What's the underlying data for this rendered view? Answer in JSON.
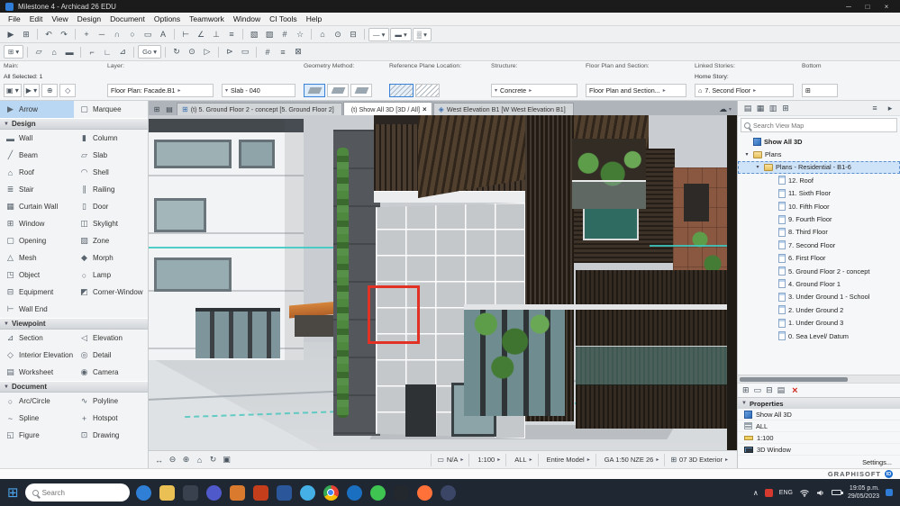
{
  "titlebar": {
    "title": "Milestone 4 - Archicad 26 EDU",
    "minimize": "─",
    "maximize": "□",
    "close": "×"
  },
  "menubar": {
    "items": [
      "File",
      "Edit",
      "View",
      "Design",
      "Document",
      "Options",
      "Teamwork",
      "Window",
      "CI Tools",
      "Help"
    ]
  },
  "toolbar_row1": {
    "icons": [
      {
        "n": "select-arrow-icon",
        "g": "▶"
      },
      {
        "n": "marquee-icon",
        "g": "⊞"
      },
      {
        "n": "sep",
        "g": "",
        "c": "sep"
      },
      {
        "n": "undo-icon",
        "g": "↶"
      },
      {
        "n": "redo-icon",
        "g": "↷"
      },
      {
        "n": "sep",
        "g": "",
        "c": "sep"
      },
      {
        "n": "pan-icon",
        "g": "+"
      },
      {
        "n": "line-icon",
        "g": "─"
      },
      {
        "n": "arc-icon",
        "g": "∩"
      },
      {
        "n": "circle-icon",
        "g": "○"
      },
      {
        "n": "rect-icon",
        "g": "▭"
      },
      {
        "n": "text-icon",
        "g": "A"
      },
      {
        "n": "sep",
        "g": "",
        "c": "sep"
      },
      {
        "n": "dimension-icon",
        "g": "⊢"
      },
      {
        "n": "angle-icon",
        "g": "∠"
      },
      {
        "n": "level-icon",
        "g": "⊥"
      },
      {
        "n": "label-icon",
        "g": "≡"
      },
      {
        "n": "sep",
        "g": "",
        "c": "sep"
      },
      {
        "n": "zone-fill-icon",
        "g": "▧"
      },
      {
        "n": "hatch-icon",
        "g": "▨"
      },
      {
        "n": "grid-snap-icon",
        "g": "#"
      },
      {
        "n": "favorites-icon",
        "g": "☆"
      },
      {
        "n": "sep",
        "g": "",
        "c": "sep"
      },
      {
        "n": "home-story-icon",
        "g": "⌂"
      },
      {
        "n": "camera-path-icon",
        "g": "⊙"
      },
      {
        "n": "layer-combine-icon",
        "g": "⊟"
      },
      {
        "n": "sep",
        "g": "",
        "c": "sep"
      },
      {
        "n": "linetype-dropdown",
        "g": "— ▾",
        "c": "chip"
      },
      {
        "n": "pen-dropdown",
        "g": "▬ ▾",
        "c": "chip"
      },
      {
        "n": "fill-dropdown",
        "g": "▒ ▾",
        "c": "chip"
      }
    ]
  },
  "toolbar_row2": {
    "icons": [
      {
        "n": "view-settings-dropdown",
        "g": "⊞ ▾",
        "c": "chip"
      },
      {
        "n": "sep",
        "g": "",
        "c": "sep"
      },
      {
        "n": "slab-edit-icon",
        "g": "▱"
      },
      {
        "n": "roof-edit-icon",
        "g": "⌂"
      },
      {
        "n": "wall-edit-icon",
        "g": "▬"
      },
      {
        "n": "sep",
        "g": "",
        "c": "sep"
      },
      {
        "n": "corner-icon",
        "g": "⌐"
      },
      {
        "n": "angle-icon",
        "g": "∟"
      },
      {
        "n": "triangle-icon",
        "g": "⊿"
      },
      {
        "n": "sep",
        "g": "",
        "c": "sep"
      },
      {
        "n": "go-dropdown",
        "g": "Go ▾",
        "c": "chip"
      },
      {
        "n": "sep",
        "g": "",
        "c": "sep"
      },
      {
        "n": "rotate-view-icon",
        "g": "↻"
      },
      {
        "n": "orbit-icon",
        "g": "⊙"
      },
      {
        "n": "walkthrough-icon",
        "g": "▷"
      },
      {
        "n": "sep",
        "g": "",
        "c": "sep"
      },
      {
        "n": "markup-flag-icon",
        "g": "⊳"
      },
      {
        "n": "note-icon",
        "g": "▭"
      },
      {
        "n": "sep",
        "g": "",
        "c": "sep"
      },
      {
        "n": "hash-icon",
        "g": "#"
      },
      {
        "n": "list-icon",
        "g": "≡"
      },
      {
        "n": "close-box-icon",
        "g": "⊠"
      }
    ]
  },
  "infobar": {
    "main_label": "Main:",
    "selected_text": "All Selected: 1",
    "main_icons": [
      {
        "n": "default-settings-icon",
        "g": "▣ ▾"
      },
      {
        "n": "arrow-mode-icon",
        "g": "▶ ▾"
      },
      {
        "n": "add-mode-icon",
        "g": "⊕"
      },
      {
        "n": "transform-icon",
        "g": "◇"
      }
    ],
    "layer_label": "Layer:",
    "layer_value": "Floor Plan: Facade.B1",
    "id_value": "Slab - 040",
    "geometry_label": "Geometry Method:",
    "refplane_label": "Reference Plane Location:",
    "structure_label": "Structure:",
    "structure_value": "Concrete",
    "fps_label": "Floor Plan and Section:",
    "fps_value": "Floor Plan and Section...",
    "linked_label": "Linked Stories:",
    "home_story_label": "Home Story:",
    "home_story_value": "7. Second Floor",
    "bottom_label": "Bottom"
  },
  "tabbar": {
    "left_icons": [
      {
        "n": "quick-options-icon",
        "g": "⊞"
      },
      {
        "n": "tab-overview-icon",
        "g": "▤"
      }
    ],
    "tabs": [
      {
        "label": "(t) 5. Ground Floor 2 - concept [5. Ground Floor 2]",
        "icon": "⊞",
        "close": "",
        "cls": ""
      },
      {
        "label": "(t) Show All 3D [3D / All]",
        "icon": "",
        "close": "×",
        "cls": "active"
      },
      {
        "label": "West Elevation B1 [W West Elevation B1]",
        "icon": "◈",
        "close": "",
        "cls": ""
      }
    ],
    "cloud_icon": "☁",
    "cloud_caret": "▾"
  },
  "toolbox": {
    "select_tools": [
      {
        "label": "Arrow",
        "icon": "▶",
        "cls": "sel"
      },
      {
        "label": "Marquee",
        "icon": "▢",
        "cls": ""
      }
    ],
    "design_header": "Design",
    "design_tools": [
      {
        "label": "Wall",
        "icon": "▬"
      },
      {
        "label": "Column",
        "icon": "▮"
      },
      {
        "label": "Beam",
        "icon": "╱"
      },
      {
        "label": "Slab",
        "icon": "▱"
      },
      {
        "label": "Roof",
        "icon": "⌂"
      },
      {
        "label": "Shell",
        "icon": "◠"
      },
      {
        "label": "Stair",
        "icon": "≣"
      },
      {
        "label": "Railing",
        "icon": "∥"
      },
      {
        "label": "Curtain Wall",
        "icon": "▦"
      },
      {
        "label": "Door",
        "icon": "▯"
      },
      {
        "label": "Window",
        "icon": "⊞"
      },
      {
        "label": "Skylight",
        "icon": "◫"
      },
      {
        "label": "Opening",
        "icon": "▢"
      },
      {
        "label": "Zone",
        "icon": "▨"
      },
      {
        "label": "Mesh",
        "icon": "△"
      },
      {
        "label": "Morph",
        "icon": "◆"
      },
      {
        "label": "Object",
        "icon": "◳"
      },
      {
        "label": "Lamp",
        "icon": "○"
      },
      {
        "label": "Equipment",
        "icon": "⊟"
      },
      {
        "label": "Corner-Window",
        "icon": "◩"
      },
      {
        "label": "Wall End",
        "icon": "⊢"
      }
    ],
    "viewpoint_header": "Viewpoint",
    "viewpoint_tools": [
      {
        "label": "Section",
        "icon": "⊿"
      },
      {
        "label": "Elevation",
        "icon": "◁"
      },
      {
        "label": "Interior Elevation",
        "icon": "◇"
      },
      {
        "label": "Detail",
        "icon": "◎"
      },
      {
        "label": "Worksheet",
        "icon": "▤"
      },
      {
        "label": "Camera",
        "icon": "◉"
      }
    ],
    "document_header": "Document",
    "document_tools": [
      {
        "label": "Arc/Circle",
        "icon": "○"
      },
      {
        "label": "Polyline",
        "icon": "∿"
      },
      {
        "label": "Spline",
        "icon": "~"
      },
      {
        "label": "Hotspot",
        "icon": "+"
      },
      {
        "label": "Figure",
        "icon": "◱"
      },
      {
        "label": "Drawing",
        "icon": "⊡"
      }
    ]
  },
  "navigator": {
    "header_icons": [
      {
        "n": "project-chooser-icon",
        "g": "▤"
      },
      {
        "n": "view-map-icon",
        "g": "▦"
      },
      {
        "n": "layout-book-icon",
        "g": "▥"
      },
      {
        "n": "publisher-icon",
        "g": "⊞"
      }
    ],
    "menu_icon": "≡",
    "expand_icon": "▸",
    "search_placeholder": "Search View Map",
    "tree": [
      {
        "label": "Show All 3D",
        "icon": "i-cube",
        "arrow": "",
        "cls": "lvl0 bold"
      },
      {
        "label": "Plans",
        "icon": "i-folder",
        "arrow": "▾",
        "cls": "lvl0"
      },
      {
        "label": "Plans - Residential - B1-6",
        "icon": "i-folder",
        "arrow": "▾",
        "cls": "lvl1 selected"
      },
      {
        "label": "12. Roof",
        "icon": "i-plan",
        "arrow": "",
        "cls": "lvl2"
      },
      {
        "label": "11. Sixth Floor",
        "icon": "i-plan",
        "arrow": "",
        "cls": "lvl2"
      },
      {
        "label": "10. Fifth Floor",
        "icon": "i-plan",
        "arrow": "",
        "cls": "lvl2"
      },
      {
        "label": "9. Fourth Floor",
        "icon": "i-plan",
        "arrow": "",
        "cls": "lvl2"
      },
      {
        "label": "8. Third Floor",
        "icon": "i-plan",
        "arrow": "",
        "cls": "lvl2"
      },
      {
        "label": "7. Second Floor",
        "icon": "i-plan",
        "arrow": "",
        "cls": "lvl2"
      },
      {
        "label": "6. First Floor",
        "icon": "i-plan",
        "arrow": "",
        "cls": "lvl2"
      },
      {
        "label": "5. Ground Floor 2 - concept",
        "icon": "i-plan",
        "arrow": "",
        "cls": "lvl2"
      },
      {
        "label": "4. Ground Floor 1",
        "icon": "i-plan",
        "arrow": "",
        "cls": "lvl2"
      },
      {
        "label": "3. Under Ground 1 - School",
        "icon": "i-plan",
        "arrow": "",
        "cls": "lvl2"
      },
      {
        "label": "2. Under Ground 2",
        "icon": "i-plan",
        "arrow": "",
        "cls": "lvl2"
      },
      {
        "label": "1. Under Ground 3",
        "icon": "i-plan",
        "arrow": "",
        "cls": "lvl2"
      },
      {
        "label": "0. Sea Level/ Datum",
        "icon": "i-plan",
        "arrow": "",
        "cls": "lvl2"
      }
    ],
    "tool_icons": [
      {
        "n": "new-viewpoint-icon",
        "g": "⊞"
      },
      {
        "n": "edit-view-icon",
        "g": "▭"
      },
      {
        "n": "clone-folder-icon",
        "g": "⊟"
      },
      {
        "n": "save-view-icon",
        "g": "▤"
      }
    ],
    "delete_icon": "×"
  },
  "properties": {
    "header": "Properties",
    "rows": [
      {
        "label": "Show All 3D",
        "icon": "i-cube"
      },
      {
        "label": "ALL",
        "icon": "i-layers"
      },
      {
        "label": "1:100",
        "icon": "i-scale"
      },
      {
        "label": "3D Window",
        "icon": "i-monitor"
      }
    ],
    "settings_label": "Settings..."
  },
  "statusbar": {
    "icons": [
      {
        "n": "pan-icon",
        "g": "↔"
      },
      {
        "n": "zoom-out-icon",
        "g": "⊖"
      },
      {
        "n": "zoom-in-icon",
        "g": "⊕"
      },
      {
        "n": "fit-view-icon",
        "g": "⌂"
      },
      {
        "n": "orbit-icon",
        "g": "↻"
      },
      {
        "n": "walk-mode-icon",
        "g": "▣"
      }
    ],
    "chips": [
      {
        "icon": "▭",
        "label": "N/A"
      },
      {
        "icon": "",
        "label": "1:100"
      },
      {
        "icon": "",
        "label": "ALL"
      },
      {
        "icon": "",
        "label": "Entire Model"
      },
      {
        "icon": "",
        "label": "GA 1:50 NZE 26"
      },
      {
        "icon": "⊞",
        "label": "07 3D Exterior"
      }
    ]
  },
  "branding": {
    "name": "GRAPHISOFT",
    "badge": "ID"
  },
  "taskbar": {
    "start_icon": "⊞",
    "search_placeholder": "Search",
    "apps": [
      {
        "name": "taskbar-edge-icon",
        "color": "#2f7fd6",
        "cls": "round"
      },
      {
        "name": "taskbar-file-explorer-icon",
        "color": "#eac054",
        "cls": ""
      },
      {
        "name": "taskbar-photos-icon",
        "color": "#39414e",
        "cls": ""
      },
      {
        "name": "taskbar-teams-icon",
        "color": "#5059c9",
        "cls": "round"
      },
      {
        "name": "taskbar-outlook-icon",
        "color": "#d97a2e",
        "cls": ""
      },
      {
        "name": "taskbar-powerpoint-icon",
        "color": "#c43e1c",
        "cls": ""
      },
      {
        "name": "taskbar-word-icon",
        "color": "#2b579a",
        "cls": ""
      },
      {
        "name": "taskbar-skype-icon",
        "color": "#45b0e6",
        "cls": "round"
      },
      {
        "name": "taskbar-chrome-icon",
        "color": "conic-gradient(#ea4335 0 120deg, #fbbc05 0 240deg, #34a853 0 360deg)",
        "cls": "chrome round"
      },
      {
        "name": "taskbar-edge-beta-icon",
        "color": "#1b6fc0",
        "cls": "round"
      },
      {
        "name": "taskbar-whatsapp-icon",
        "color": "#3fc351",
        "cls": "round"
      },
      {
        "name": "taskbar-camera-icon",
        "color": "#23272e",
        "cls": ""
      },
      {
        "name": "taskbar-firefox-icon",
        "color": "#ff7139",
        "cls": "round"
      },
      {
        "name": "taskbar-discord-icon",
        "color": "#3b4566",
        "cls": "round"
      }
    ],
    "tray": {
      "chevron": "∧",
      "lang": "ENG",
      "time": "19:05 p.m.",
      "date": "29/05/2023"
    }
  }
}
